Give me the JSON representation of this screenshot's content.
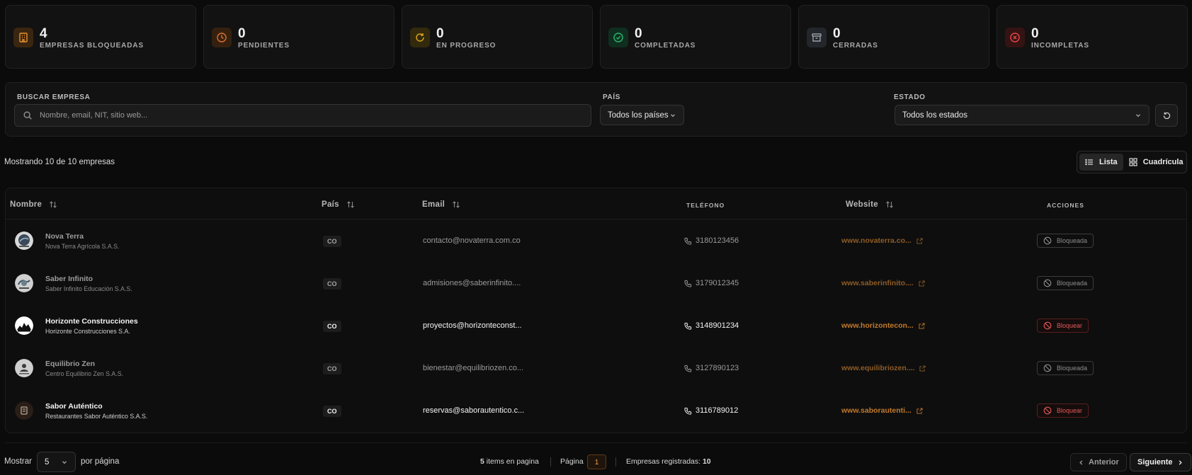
{
  "stats": [
    {
      "value": "4",
      "label": "EMPRESAS BLOQUEADAS",
      "icon": "building-icon",
      "color": "#e8912d",
      "bg": "#3a2610"
    },
    {
      "value": "0",
      "label": "PENDIENTES",
      "icon": "clock-icon",
      "color": "#e0702b",
      "bg": "#35200f"
    },
    {
      "value": "0",
      "label": "EN PROGRESO",
      "icon": "refresh-icon",
      "color": "#d9a320",
      "bg": "#33290c"
    },
    {
      "value": "0",
      "label": "COMPLETADAS",
      "icon": "check-circle-icon",
      "color": "#28b36b",
      "bg": "#0f2e1f"
    },
    {
      "value": "0",
      "label": "CERRADAS",
      "icon": "archive-icon",
      "color": "#9aa0a8",
      "bg": "#23262b"
    },
    {
      "value": "0",
      "label": "INCOMPLETAS",
      "icon": "x-circle-icon",
      "color": "#e04646",
      "bg": "#351313"
    }
  ],
  "filters": {
    "search_label": "BUSCAR EMPRESA",
    "search_placeholder": "Nombre, email, NIT, sitio web...",
    "country_label": "PAÍS",
    "country_value": "Todos los países",
    "status_label": "ESTADO",
    "status_value": "Todos los estados"
  },
  "summary": {
    "showing": "Mostrando 10 de 10 empresas",
    "view_list": "Lista",
    "view_grid": "Cuadrícula"
  },
  "table": {
    "headers": {
      "name": "Nombre",
      "country": "País",
      "email": "Email",
      "phone": "TELÉFONO",
      "website": "Website",
      "actions": "ACCIONES"
    },
    "rows": [
      {
        "name": "Nova Terra",
        "legal": "Nova Terra Agrícola S.A.S.",
        "country": "CO",
        "email": "contacto@novaterra.com.co",
        "phone": "3180123456",
        "website": "www.novaterra.co...",
        "action": "Bloqueada",
        "blocked": true
      },
      {
        "name": "Saber Infinito",
        "legal": "Saber Infinito Educación S.A.S.",
        "country": "CO",
        "email": "admisiones@saberinfinito....",
        "phone": "3179012345",
        "website": "www.saberinfinito....",
        "action": "Bloqueada",
        "blocked": true
      },
      {
        "name": "Horizonte Construcciones",
        "legal": "Horizonte Construcciones S.A.",
        "country": "CO",
        "email": "proyectos@horizonteconst...",
        "phone": "3148901234",
        "website": "www.horizontecon...",
        "action": "Bloquear",
        "blocked": false
      },
      {
        "name": "Equilibrio Zen",
        "legal": "Centro Equilibrio Zen S.A.S.",
        "country": "CO",
        "email": "bienestar@equilibriozen.co...",
        "phone": "3127890123",
        "website": "www.equilibriozen....",
        "action": "Bloqueada",
        "blocked": true
      },
      {
        "name": "Sabor Auténtico",
        "legal": "Restaurantes Sabor Auténtico S.A.S.",
        "country": "CO",
        "email": "reservas@saborautentico.c...",
        "phone": "3116789012",
        "website": "www.saborautenti...",
        "action": "Bloquear",
        "blocked": false
      }
    ]
  },
  "footer": {
    "show_label": "Mostrar",
    "per_page_value": "5",
    "per_page_label": "por página",
    "items_count": "5",
    "items_label": "items en pagina",
    "page_label": "Página",
    "page_number": "1",
    "registered_label": "Empresas registradas:",
    "registered_count": "10",
    "prev_label": "Anterior",
    "next_label": "Siguiente"
  }
}
